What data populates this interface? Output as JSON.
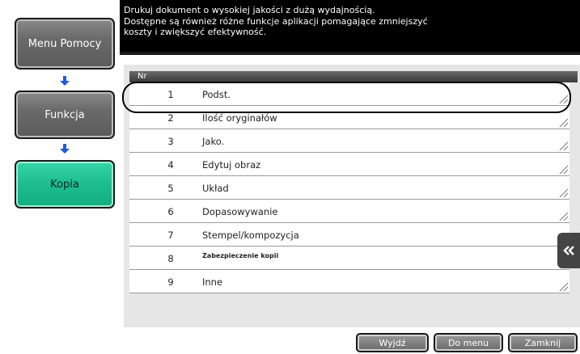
{
  "nav": {
    "items": [
      {
        "label": "Menu Pomocy"
      },
      {
        "label": "Funkcja"
      },
      {
        "label": "Kopia"
      }
    ],
    "arrow_color": "#1e5bd8",
    "active_color": "#1fbf90"
  },
  "header": {
    "lines": [
      "Drukuj dokument o wysokiej jakości z dużą wydajnością.",
      "Dostępne są również różne funkcje aplikacji pomagające zmniejszyć",
      "koszty i zwiększyć efektywność."
    ]
  },
  "list": {
    "column_header": "Nr",
    "rows": [
      {
        "num": "1",
        "label": "Podst."
      },
      {
        "num": "2",
        "label": "Ilość oryginałów"
      },
      {
        "num": "3",
        "label": "Jako."
      },
      {
        "num": "4",
        "label": "Edytuj obraz"
      },
      {
        "num": "5",
        "label": "Układ"
      },
      {
        "num": "6",
        "label": "Dopasowywanie"
      },
      {
        "num": "7",
        "label": "Stempel/kompozycja"
      },
      {
        "num": "8",
        "label": "Zabezpieczenie kopii"
      },
      {
        "num": "9",
        "label": "Inne"
      }
    ],
    "highlighted_row": 1
  },
  "side_tab": {
    "icon": "double-chevron-left-icon"
  },
  "footer": {
    "buttons": [
      {
        "label": "Wyjdź"
      },
      {
        "label": "Do menu"
      },
      {
        "label": "Zamknij"
      }
    ]
  }
}
